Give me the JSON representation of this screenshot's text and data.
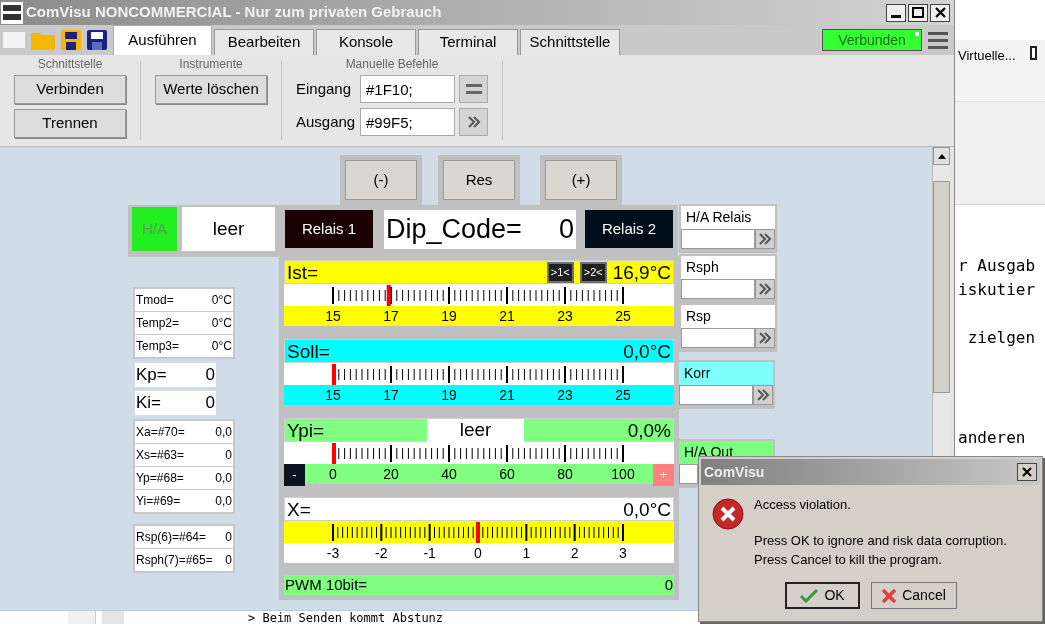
{
  "window": {
    "title": "ComVisu NONCOMMERCIAL - Nur zum privaten Gebrauch"
  },
  "tabs": [
    {
      "label": "Ausführen",
      "selected": true
    },
    {
      "label": "Bearbeiten",
      "selected": false
    },
    {
      "label": "Konsole",
      "selected": false
    },
    {
      "label": "Terminal",
      "selected": false
    },
    {
      "label": "Schnittstelle",
      "selected": false
    }
  ],
  "connection_status": "Verbunden",
  "ribbon": {
    "groups": [
      {
        "kind": "buttons",
        "title": "Schnittstelle",
        "buttons": [
          "Verbinden",
          "Trennen"
        ]
      },
      {
        "kind": "buttons",
        "title": "Instrumente",
        "buttons": [
          "Werte löschen"
        ]
      },
      {
        "kind": "commands",
        "title": "Manuelle Befehle",
        "fields": [
          {
            "label": "Eingang",
            "value": "#1F10;",
            "kind": "equals"
          },
          {
            "label": "Ausgang",
            "value": "#99F5;",
            "kind": "send"
          }
        ]
      }
    ]
  },
  "panel": {
    "step_buttons": [
      "(-)",
      "Res",
      "(+)"
    ],
    "mode": {
      "label": "H/A",
      "value": "leer"
    },
    "relays": [
      {
        "label": "Relais 1",
        "color": "#1a0000"
      },
      {
        "label": "Relais 2",
        "color": "#000d1a"
      }
    ],
    "dip_code": {
      "label": "Dip_Code=",
      "value": "0"
    },
    "readout_groups": [
      {
        "kind": "small",
        "items": [
          {
            "label": "Tmod=",
            "value": "0°C"
          },
          {
            "label": "Temp2=",
            "value": "0°C"
          },
          {
            "label": "Temp3=",
            "value": "0°C"
          }
        ]
      },
      {
        "kind": "large",
        "items": [
          {
            "label": "Kp=",
            "value": "0"
          },
          {
            "label": "Ki=",
            "value": "0"
          }
        ]
      },
      {
        "kind": "small",
        "items": [
          {
            "label": "Xa=#70=",
            "value": "0,0"
          },
          {
            "label": "Xs=#63=",
            "value": "0"
          },
          {
            "label": "Yp=#68=",
            "value": "0,0"
          },
          {
            "label": "Yi=#69=",
            "value": "0,0"
          }
        ]
      },
      {
        "kind": "small",
        "items": [
          {
            "label": "Rsp(6)=#64=",
            "value": "0"
          },
          {
            "label": "Rsph(7)=#65=",
            "value": "0"
          }
        ]
      }
    ],
    "gauges": [
      {
        "kind": "standard",
        "label": "Ist=",
        "value": "16,9°C",
        "color": "#ffff00",
        "level": 0.19,
        "badges": [
          ">1<",
          ">2<"
        ],
        "ticks": [
          "15",
          "17",
          "19",
          "21",
          "23",
          "25"
        ]
      },
      {
        "kind": "standard",
        "label": "Soll=",
        "value": "0,0°C",
        "color": "#00ffff",
        "level": 0,
        "ticks": [
          "15",
          "17",
          "19",
          "21",
          "23",
          "25"
        ]
      },
      {
        "kind": "output",
        "label": "Ypi=",
        "status": "leer",
        "value": "0,0%",
        "color": "#80ff80",
        "level": 0,
        "minus": "-",
        "plus": "+",
        "ticks": [
          "0",
          "20",
          "40",
          "60",
          "80",
          "100"
        ]
      },
      {
        "kind": "deviation",
        "label": "X=",
        "value": "0,0°C",
        "color": "#ffff00",
        "level": 0.5,
        "ticks": [
          "-3",
          "-2",
          "-1",
          "0",
          "1",
          "2",
          "3"
        ]
      }
    ],
    "pwm": {
      "label": "PWM 10bit=",
      "value": "0"
    },
    "setpoints": [
      {
        "label": "H/A Relais",
        "color": "#ffffff"
      },
      {
        "label": "Rsph",
        "color": "#ffffff"
      },
      {
        "label": "Rsp",
        "color": "#ffffff"
      },
      {
        "label": "Korr",
        "color": "#80ffff"
      },
      {
        "label": "H/A Out",
        "color": "#80ff80"
      }
    ]
  },
  "background_window": {
    "tab": "Virtuelle...",
    "lines": [
      "r Ausgab",
      "iskutier",
      " zielgen",
      "anderen"
    ],
    "bottom_line": "> Beim Senden kommt Abstunz"
  },
  "dialog": {
    "title": "ComVisu",
    "message": "Access violation.",
    "details": [
      "Press OK to ignore and risk data corruption.",
      "Press Cancel to kill the program."
    ],
    "buttons": [
      {
        "kind": "ok",
        "label": "OK"
      },
      {
        "kind": "cancel",
        "label": "Cancel"
      }
    ]
  }
}
